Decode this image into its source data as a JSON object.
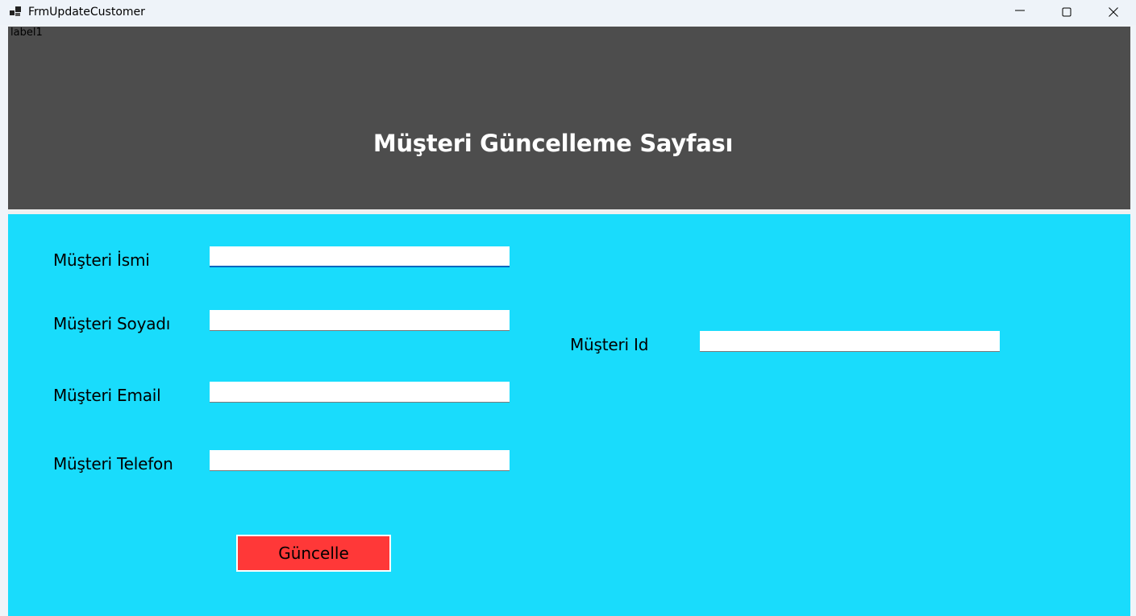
{
  "window": {
    "title": "FrmUpdateCustomer"
  },
  "header": {
    "label1": "label1",
    "title": "Müşteri Güncelleme Sayfası"
  },
  "form": {
    "name_label": "Müşteri İsmi",
    "name_value": "",
    "surname_label": "Müşteri Soyadı",
    "surname_value": "",
    "email_label": "Müşteri Email",
    "email_value": "",
    "phone_label": "Müşteri Telefon",
    "phone_value": "",
    "id_label": "Müşteri Id",
    "id_value": "",
    "update_button": "Güncelle"
  },
  "colors": {
    "header_bg": "#4d4d4d",
    "body_bg": "#19dcfc",
    "button_bg": "#ff3838"
  }
}
